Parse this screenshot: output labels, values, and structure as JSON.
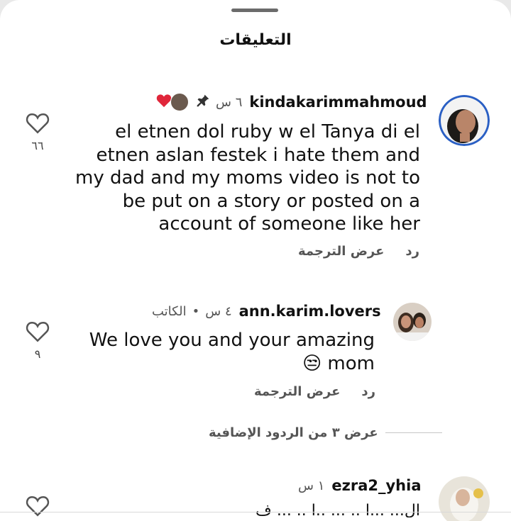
{
  "header": {
    "title": "التعليقات"
  },
  "comments": [
    {
      "username": "kindakarimmahmoud",
      "time": "٦ س",
      "text_lines": [
        "el etnen dol ruby w el Tanya di el",
        "etnen aslan festek i hate them and",
        "my dad and my moms video is not to",
        "be put on a story or posted on a",
        "account of someone like her"
      ],
      "like_count": "٦٦",
      "reply_label": "رد",
      "translate_label": "عرض الترجمة"
    },
    {
      "username": "ann.karim.lovers",
      "time": "٤ س",
      "badge": "الكاتب",
      "text_lines": [
        "We love you and your amazing",
        "😒 mom"
      ],
      "like_count": "٩",
      "reply_label": "رد",
      "translate_label": "عرض الترجمة",
      "more_replies": "عرض ٣ من الردود الإضافية"
    },
    {
      "username": "ezra2_yhia",
      "time": "١ س",
      "text_partial": "ال... ...ا .. ... ..ا .. ... ف"
    }
  ],
  "colors": {
    "heart_red": "#e0263a",
    "text": "#111111",
    "meta": "#555555"
  }
}
